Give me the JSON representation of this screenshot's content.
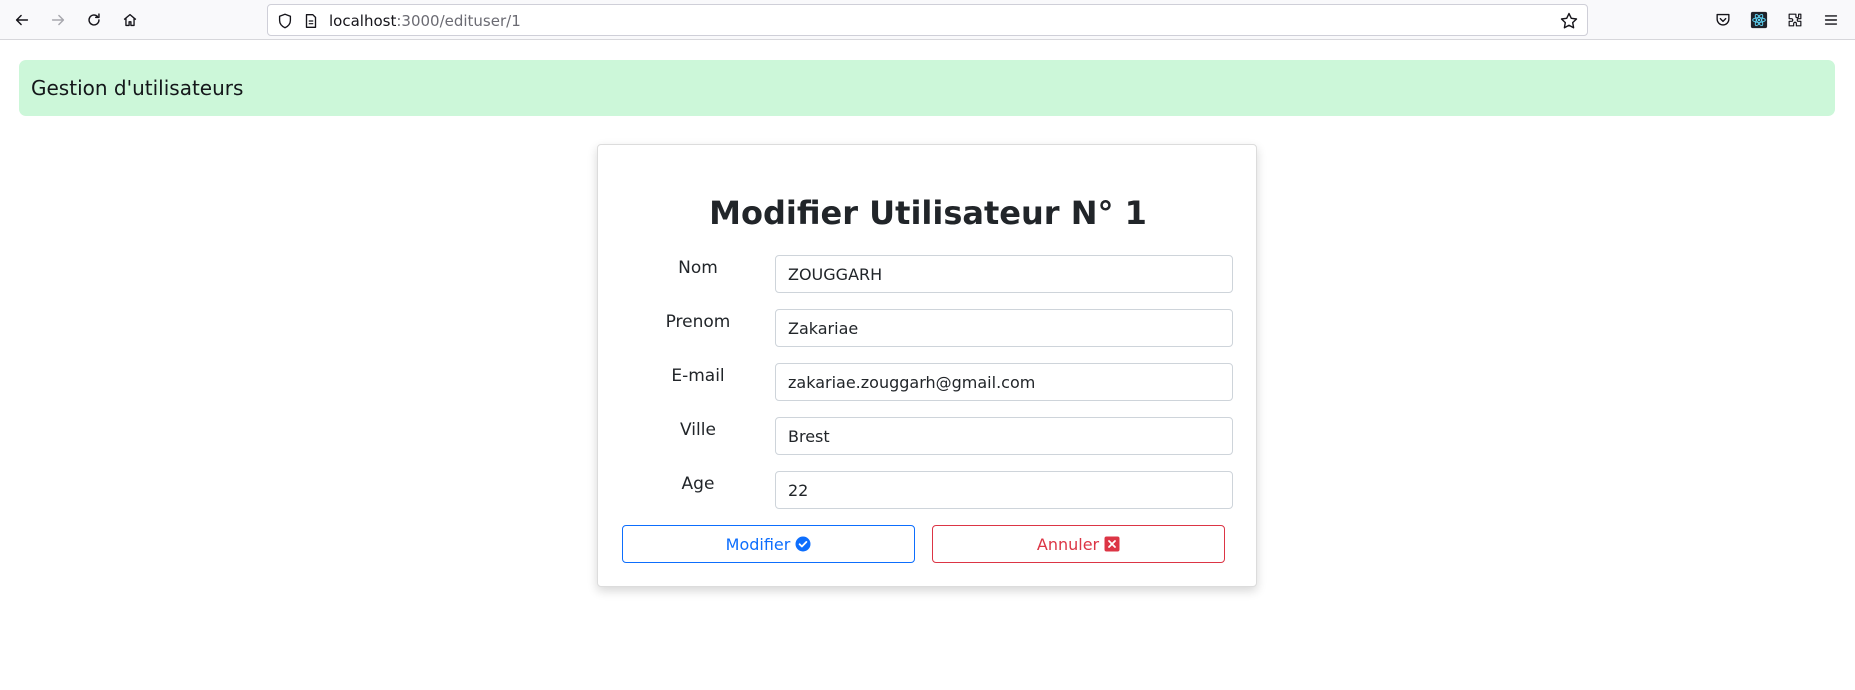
{
  "browser": {
    "url_host": "localhost",
    "url_path": ":3000/edituser/1",
    "icons": [
      "back-icon",
      "forward-icon",
      "reload-icon",
      "home-icon",
      "shield-icon",
      "page-icon",
      "bookmark-star-icon",
      "pocket-icon",
      "react-devtools-icon",
      "extensions-icon",
      "menu-icon"
    ]
  },
  "header": {
    "title": "Gestion d'utilisateurs",
    "background_color": "#ccf7d9"
  },
  "form": {
    "title": "Modifier Utilisateur N° 1",
    "fields": [
      {
        "label": "Nom",
        "value": "ZOUGGARH"
      },
      {
        "label": "Prenom",
        "value": "Zakariae"
      },
      {
        "label": "E-mail",
        "value": "zakariae.zouggarh@gmail.com"
      },
      {
        "label": "Ville",
        "value": "Brest"
      },
      {
        "label": "Age",
        "value": "22"
      }
    ],
    "submit_label": "Modifier",
    "cancel_label": "Annuler",
    "primary_color": "#0d6efd",
    "danger_color": "#dc3545"
  }
}
